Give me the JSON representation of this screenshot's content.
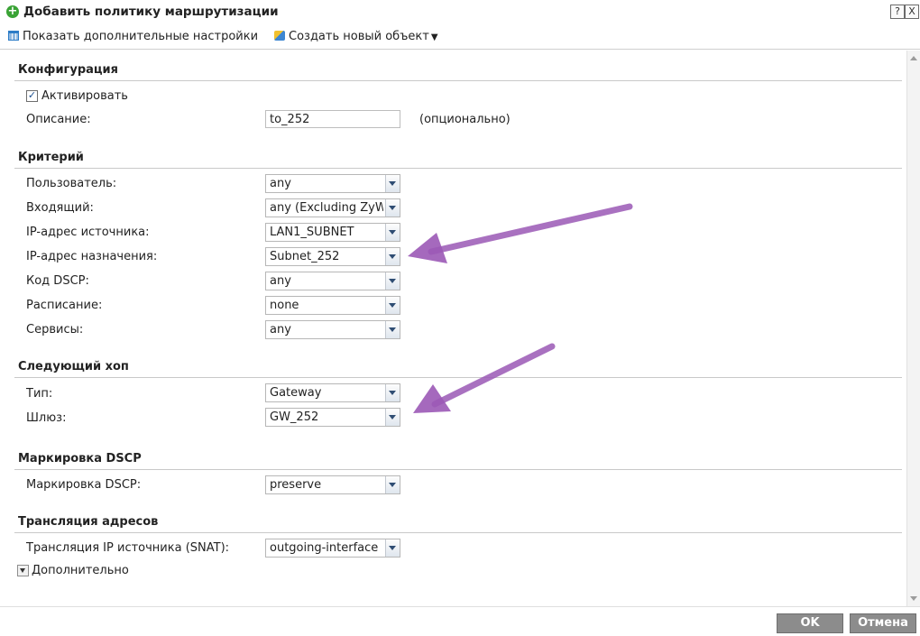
{
  "window": {
    "title": "Добавить политику маршрутизации",
    "help_label": "?",
    "close_label": "X"
  },
  "toolbar": {
    "show_advanced": "Показать дополнительные настройки",
    "create_object": "Создать новый объект"
  },
  "configuration": {
    "title": "Конфигурация",
    "activate_label": "Активировать",
    "activate_checked": true,
    "description_label": "Описание:",
    "description_value": "to_252",
    "optional_note": "(опционально)"
  },
  "criteria": {
    "title": "Критерий",
    "fields": [
      {
        "label": "Пользователь:",
        "value": "any"
      },
      {
        "label": "Входящий:",
        "value": "any (Excluding ZyW"
      },
      {
        "label": "IP-адрес источника:",
        "value": "LAN1_SUBNET"
      },
      {
        "label": "IP-адрес назначения:",
        "value": "Subnet_252"
      },
      {
        "label": "Код DSCP:",
        "value": "any"
      },
      {
        "label": "Расписание:",
        "value": "none"
      },
      {
        "label": "Сервисы:",
        "value": "any"
      }
    ]
  },
  "next_hop": {
    "title": "Следующий хоп",
    "type_label": "Тип:",
    "type_value": "Gateway",
    "gateway_label": "Шлюз:",
    "gateway_value": "GW_252"
  },
  "dscp_marking": {
    "title": "Маркировка DSCP",
    "label": "Маркировка DSCP:",
    "value": "preserve"
  },
  "address_translation": {
    "title": "Трансляция адресов",
    "snat_label": "Трансляция IP источника (SNAT):",
    "snat_value": "outgoing-interface"
  },
  "advanced": {
    "label": "Дополнительно"
  },
  "footer": {
    "ok_label": "OK",
    "cancel_label": "Отмена"
  },
  "colors": {
    "annotation_arrow": "#9b59b6",
    "button_gray": "#8c8c8c",
    "title_icon_green": "#3aa335"
  }
}
